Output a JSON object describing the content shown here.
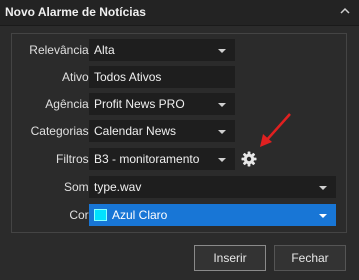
{
  "window": {
    "title": "Novo Alarme de Notícias"
  },
  "form": {
    "relevancia": {
      "label": "Relevância:",
      "value": "Alta"
    },
    "ativo": {
      "label": "Ativo:",
      "value": "Todos Ativos"
    },
    "agencia": {
      "label": "Agência:",
      "value": "Profit News PRO"
    },
    "categorias": {
      "label": "Categorias:",
      "value": "Calendar News"
    },
    "filtros": {
      "label": "Filtros:",
      "value": "B3 - monitoramento"
    },
    "som": {
      "label": "Som:",
      "value": "type.wav"
    },
    "cor": {
      "label": "Cor:",
      "value": "Azul Claro",
      "swatch_color": "#00e0ff"
    }
  },
  "icons": {
    "filter_settings": "gear-icon",
    "annotation": "red-arrow-icon"
  },
  "buttons": {
    "insert": "Inserir",
    "close": "Fechar"
  },
  "colors": {
    "accent": "#1876d6",
    "annotation": "#e02020"
  }
}
